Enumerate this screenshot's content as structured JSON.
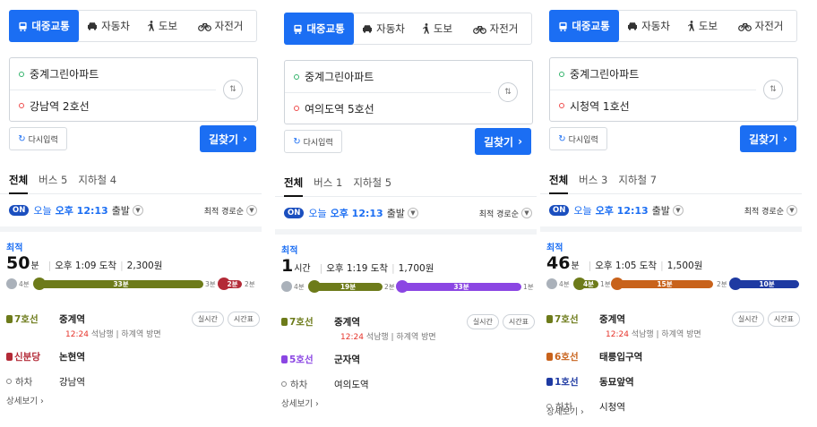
{
  "modes": [
    "대중교통",
    "자동차",
    "도보",
    "자전거"
  ],
  "reset_label": "다시입력",
  "go_label": "길찾기",
  "origin": "중계그린아파트",
  "on_badge": "ON",
  "today": "오늘",
  "dep_time": "오후 12:13",
  "dep_word": "출발",
  "sort_label": "최적 경로순",
  "best_label": "최적",
  "detail_label": "상세보기",
  "alight_label": "하차",
  "colors": {
    "accent": "#1b6ef3",
    "line7": "#6d7b1a",
    "shinbundang": "#b32a37",
    "line5": "#8b46e3",
    "line6": "#c8621b",
    "line1": "#1e3aa2"
  },
  "panels": [
    {
      "destination": "강남역 2호선",
      "tabs": [
        "전체",
        "버스 5",
        "지하철 4"
      ],
      "duration_num": "50",
      "duration_unit": "분",
      "arrival": "오후 1:09 도착",
      "fare": "2,300원",
      "bar": {
        "walk_start": "4분",
        "segments": [
          {
            "label": "33분",
            "color": "#6d7b1a"
          },
          {
            "label": "2분",
            "color": "#b32a37"
          }
        ],
        "mid_walk": "3분",
        "walk_end": "2분"
      },
      "steps": [
        {
          "line": "7호선",
          "color": "#6d7b1a",
          "station": "중계역",
          "info_time": "12:24",
          "info_text": "석남행 | 하계역 방면",
          "btn1": "실시간",
          "btn2": "시간표"
        },
        {
          "line": "신분당",
          "color": "#b32a37",
          "station": "논현역"
        },
        {
          "line": "하차",
          "station": "강남역",
          "alight": true
        }
      ]
    },
    {
      "destination": "여의도역 5호선",
      "tabs": [
        "전체",
        "버스 1",
        "지하철 5"
      ],
      "duration_num": "1",
      "duration_unit": "시간",
      "arrival": "오후 1:19 도착",
      "fare": "1,700원",
      "bar": {
        "walk_start": "4분",
        "segments": [
          {
            "label": "19분",
            "color": "#6d7b1a"
          },
          {
            "label": "33분",
            "color": "#8b46e3"
          }
        ],
        "mid_walk": "2분",
        "walk_end": "1분"
      },
      "steps": [
        {
          "line": "7호선",
          "color": "#6d7b1a",
          "station": "중계역",
          "info_time": "12:24",
          "info_text": "석남행 | 하계역 방면",
          "btn1": "실시간",
          "btn2": "시간표"
        },
        {
          "line": "5호선",
          "color": "#8b46e3",
          "station": "군자역"
        },
        {
          "line": "하차",
          "station": "여의도역",
          "alight": true
        }
      ]
    },
    {
      "destination": "시청역 1호선",
      "tabs": [
        "전체",
        "버스 3",
        "지하철 7"
      ],
      "duration_num": "46",
      "duration_unit": "분",
      "arrival": "오후 1:05 도착",
      "fare": "1,500원",
      "bar": {
        "walk_start": "4분",
        "segments": [
          {
            "label": "4분",
            "color": "#6d7b1a"
          },
          {
            "label": "15분",
            "color": "#c8621b"
          },
          {
            "label": "10분",
            "color": "#1e3aa2"
          }
        ],
        "mid_walk": "1분",
        "mid_walk2": "2분"
      },
      "steps": [
        {
          "line": "7호선",
          "color": "#6d7b1a",
          "station": "중계역",
          "info_time": "12:24",
          "info_text": "석남행 | 하계역 방면",
          "btn1": "실시간",
          "btn2": "시간표"
        },
        {
          "line": "6호선",
          "color": "#c8621b",
          "station": "태릉입구역"
        },
        {
          "line": "1호선",
          "color": "#1e3aa2",
          "station": "동묘앞역"
        },
        {
          "line": "하차",
          "station": "시청역",
          "alight": true
        }
      ]
    }
  ]
}
